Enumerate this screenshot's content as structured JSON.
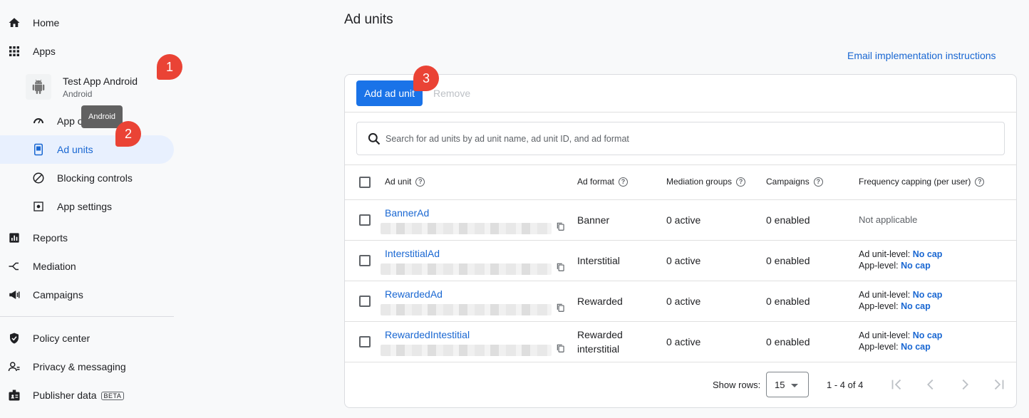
{
  "sidebar": {
    "home": "Home",
    "apps": "Apps",
    "app_name": "Test App Android",
    "app_platform": "Android",
    "tooltip": "Android",
    "app_overview": "App o",
    "ad_units": "Ad units",
    "blocking_controls": "Blocking controls",
    "app_settings": "App settings",
    "reports": "Reports",
    "mediation": "Mediation",
    "campaigns": "Campaigns",
    "policy_center": "Policy center",
    "privacy_messaging": "Privacy & messaging",
    "publisher_data": "Publisher data",
    "beta": "BETA"
  },
  "badges": [
    "1",
    "2",
    "3"
  ],
  "main": {
    "title": "Ad units",
    "email_link": "Email implementation instructions",
    "add_button": "Add ad unit",
    "remove_button": "Remove",
    "search_placeholder": "Search for ad units by ad unit name, ad unit ID, and ad format"
  },
  "table": {
    "headers": {
      "ad_unit": "Ad unit",
      "ad_format": "Ad format",
      "mediation_groups": "Mediation groups",
      "campaigns": "Campaigns",
      "frequency": "Frequency capping (per user)"
    },
    "rows": [
      {
        "name": "BannerAd",
        "format": "Banner",
        "format2": "",
        "mediation": "0 active",
        "campaigns": "0 enabled",
        "freq_na": "Not applicable"
      },
      {
        "name": "InterstitialAd",
        "format": "Interstitial",
        "format2": "",
        "mediation": "0 active",
        "campaigns": "0 enabled",
        "freq_l1": "Ad unit-level: ",
        "freq_v1": "No cap",
        "freq_l2": "App-level: ",
        "freq_v2": "No cap"
      },
      {
        "name": "RewardedAd",
        "format": "Rewarded",
        "format2": "",
        "mediation": "0 active",
        "campaigns": "0 enabled",
        "freq_l1": "Ad unit-level: ",
        "freq_v1": "No cap",
        "freq_l2": "App-level: ",
        "freq_v2": "No cap"
      },
      {
        "name": "RewardedIntestitial",
        "format": "Rewarded",
        "format2": "interstitial",
        "mediation": "0 active",
        "campaigns": "0 enabled",
        "freq_l1": "Ad unit-level: ",
        "freq_v1": "No cap",
        "freq_l2": "App-level: ",
        "freq_v2": "No cap"
      }
    ]
  },
  "pagination": {
    "show_rows_label": "Show rows:",
    "rows_value": "15",
    "range": "1 - 4 of 4"
  },
  "colors": {
    "accent": "#1a73e8",
    "link": "#1967d2",
    "badge": "#ea4335"
  }
}
